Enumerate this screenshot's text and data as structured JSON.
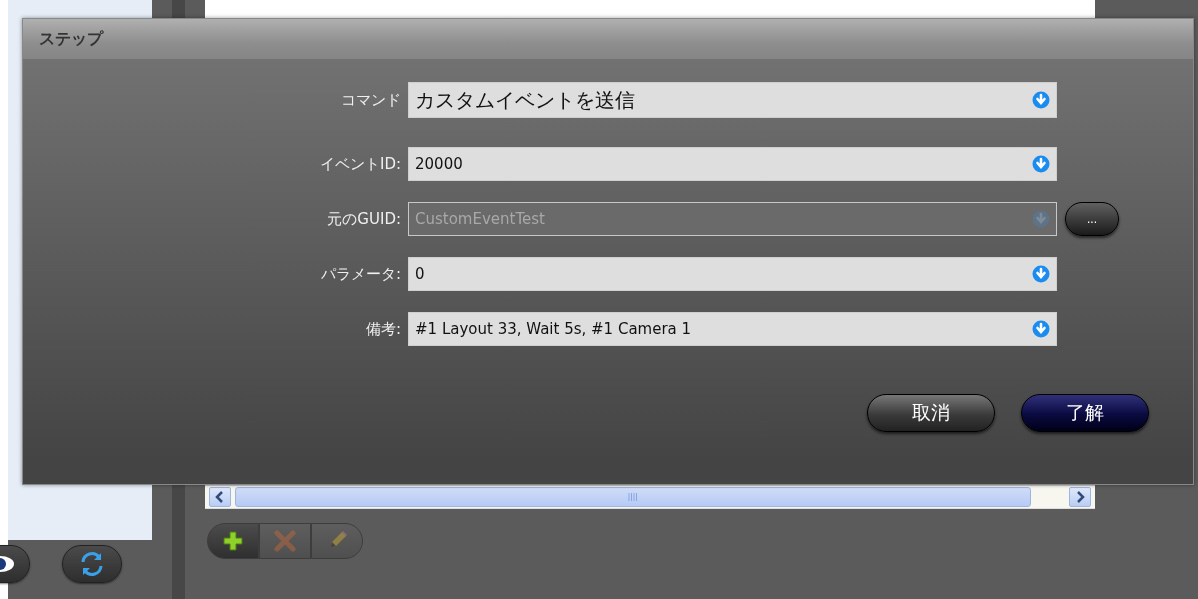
{
  "dialog": {
    "title": "ステップ",
    "fields": [
      {
        "kind": "command",
        "label": "コマンド",
        "value": "カスタムイベントを送信",
        "disabled": false
      },
      {
        "kind": "field",
        "label": "イベントID:",
        "value": "20000",
        "disabled": false
      },
      {
        "kind": "field",
        "label": "元のGUID:",
        "value": "CustomEventTest",
        "disabled": true,
        "browse_button": "..."
      },
      {
        "kind": "field",
        "label": "パラメータ:",
        "value": "0",
        "disabled": false
      },
      {
        "kind": "field",
        "label": "備考:",
        "value": "#1 Layout 33, Wait 5s, #1 Camera 1",
        "disabled": false
      }
    ],
    "buttons": [
      {
        "kind": "cancel",
        "label": "取消"
      },
      {
        "kind": "default",
        "label": "了解"
      }
    ]
  },
  "toolbar": [
    {
      "kind": "add",
      "disabled": false
    },
    {
      "kind": "delete",
      "disabled": true
    },
    {
      "kind": "edit",
      "disabled": true
    }
  ]
}
